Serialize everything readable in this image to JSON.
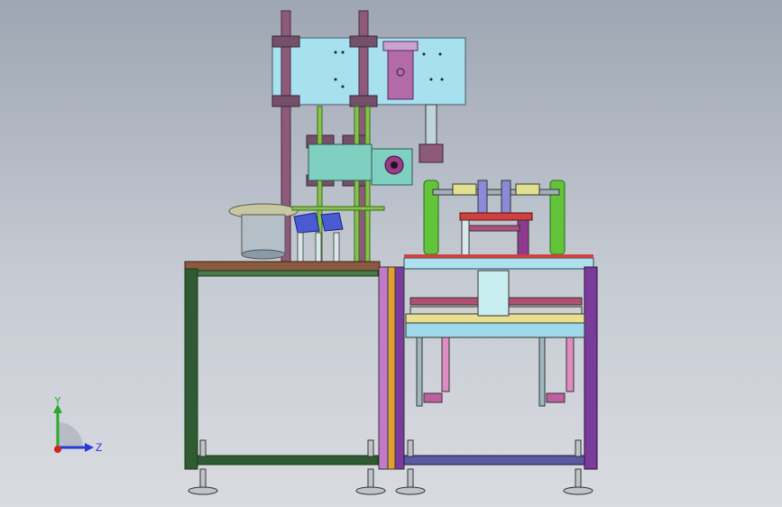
{
  "viewport": {
    "background": "#b7bdc7",
    "model_colors": {
      "column_plate": "#a7e0ee",
      "post": "#8e5a7a",
      "clamp": "#74506a",
      "green_rod": "#86c34a",
      "frame_green": "#2f5a32",
      "frame_purple": "#7a3c9a",
      "frame_orange": "#e0a030",
      "bowl": "#b5bfc8",
      "cylinder": "#63c43b",
      "blue_part": "#4a5ad0",
      "pink": "#e08cc0"
    }
  },
  "triad": {
    "x_label": "",
    "y_label": "Y",
    "z_label": "Z",
    "y_color": "#2aa82a",
    "z_color": "#2a3ad8",
    "x_color": "#d02020"
  }
}
